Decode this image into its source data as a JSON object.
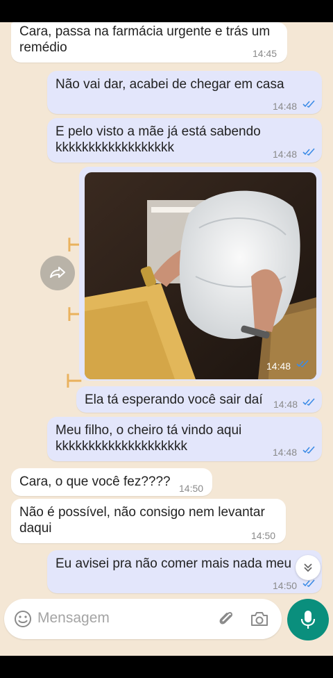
{
  "messages": [
    {
      "text": "Cara, passa na farmácia urgente e trás um remédio",
      "time": "14:45",
      "direction": "in"
    },
    {
      "text": "Não vai dar, acabei de chegar em casa",
      "time": "14:48",
      "direction": "out",
      "status": "read"
    },
    {
      "text": "E pelo visto a mãe já está sabendo kkkkkkkkkkkkkkkkkk",
      "time": "14:48",
      "direction": "out",
      "status": "read"
    },
    {
      "type": "image",
      "time": "14:48",
      "direction": "out",
      "status": "read"
    },
    {
      "text": "Ela tá esperando você sair daí",
      "time": "14:48",
      "direction": "out",
      "status": "read"
    },
    {
      "text": "Meu filho, o cheiro tá vindo aqui kkkkkkkkkkkkkkkkkkkk",
      "time": "14:48",
      "direction": "out",
      "status": "read"
    },
    {
      "text": "Cara, o que você fez????",
      "time": "14:50",
      "direction": "in"
    },
    {
      "text": "Não é possível, não consigo nem levantar daqui",
      "time": "14:50",
      "direction": "in"
    },
    {
      "text": "Eu avisei pra não comer mais nada meu",
      "time": "14:50",
      "direction": "out",
      "status": "read"
    }
  ],
  "lines": {
    "m1a": "Cara, passa na farmácia urgente e trás um",
    "m1b": "remédio",
    "m3a": "E pelo visto a mãe já está sabendo",
    "m3b": "kkkkkkkkkkkkkkkkkk",
    "m6a": "Meu filho, o cheiro tá vindo aqui",
    "m6b": "kkkkkkkkkkkkkkkkkkkk",
    "m8a": "Não é possível, não consigo nem levantar",
    "m8b": "daqui"
  },
  "composer": {
    "placeholder": "Mensagem"
  },
  "colors": {
    "tick_read": "#3b8be6",
    "accent": "#0a8f7d",
    "incoming": "#ffffff",
    "outgoing": "#e3e6fb",
    "wallpaper": "#f4e7d5"
  },
  "icons": [
    "forward-icon",
    "emoji-icon",
    "attach-icon",
    "camera-icon",
    "mic-icon",
    "chevron-down-double-icon",
    "double-check-icon"
  ]
}
